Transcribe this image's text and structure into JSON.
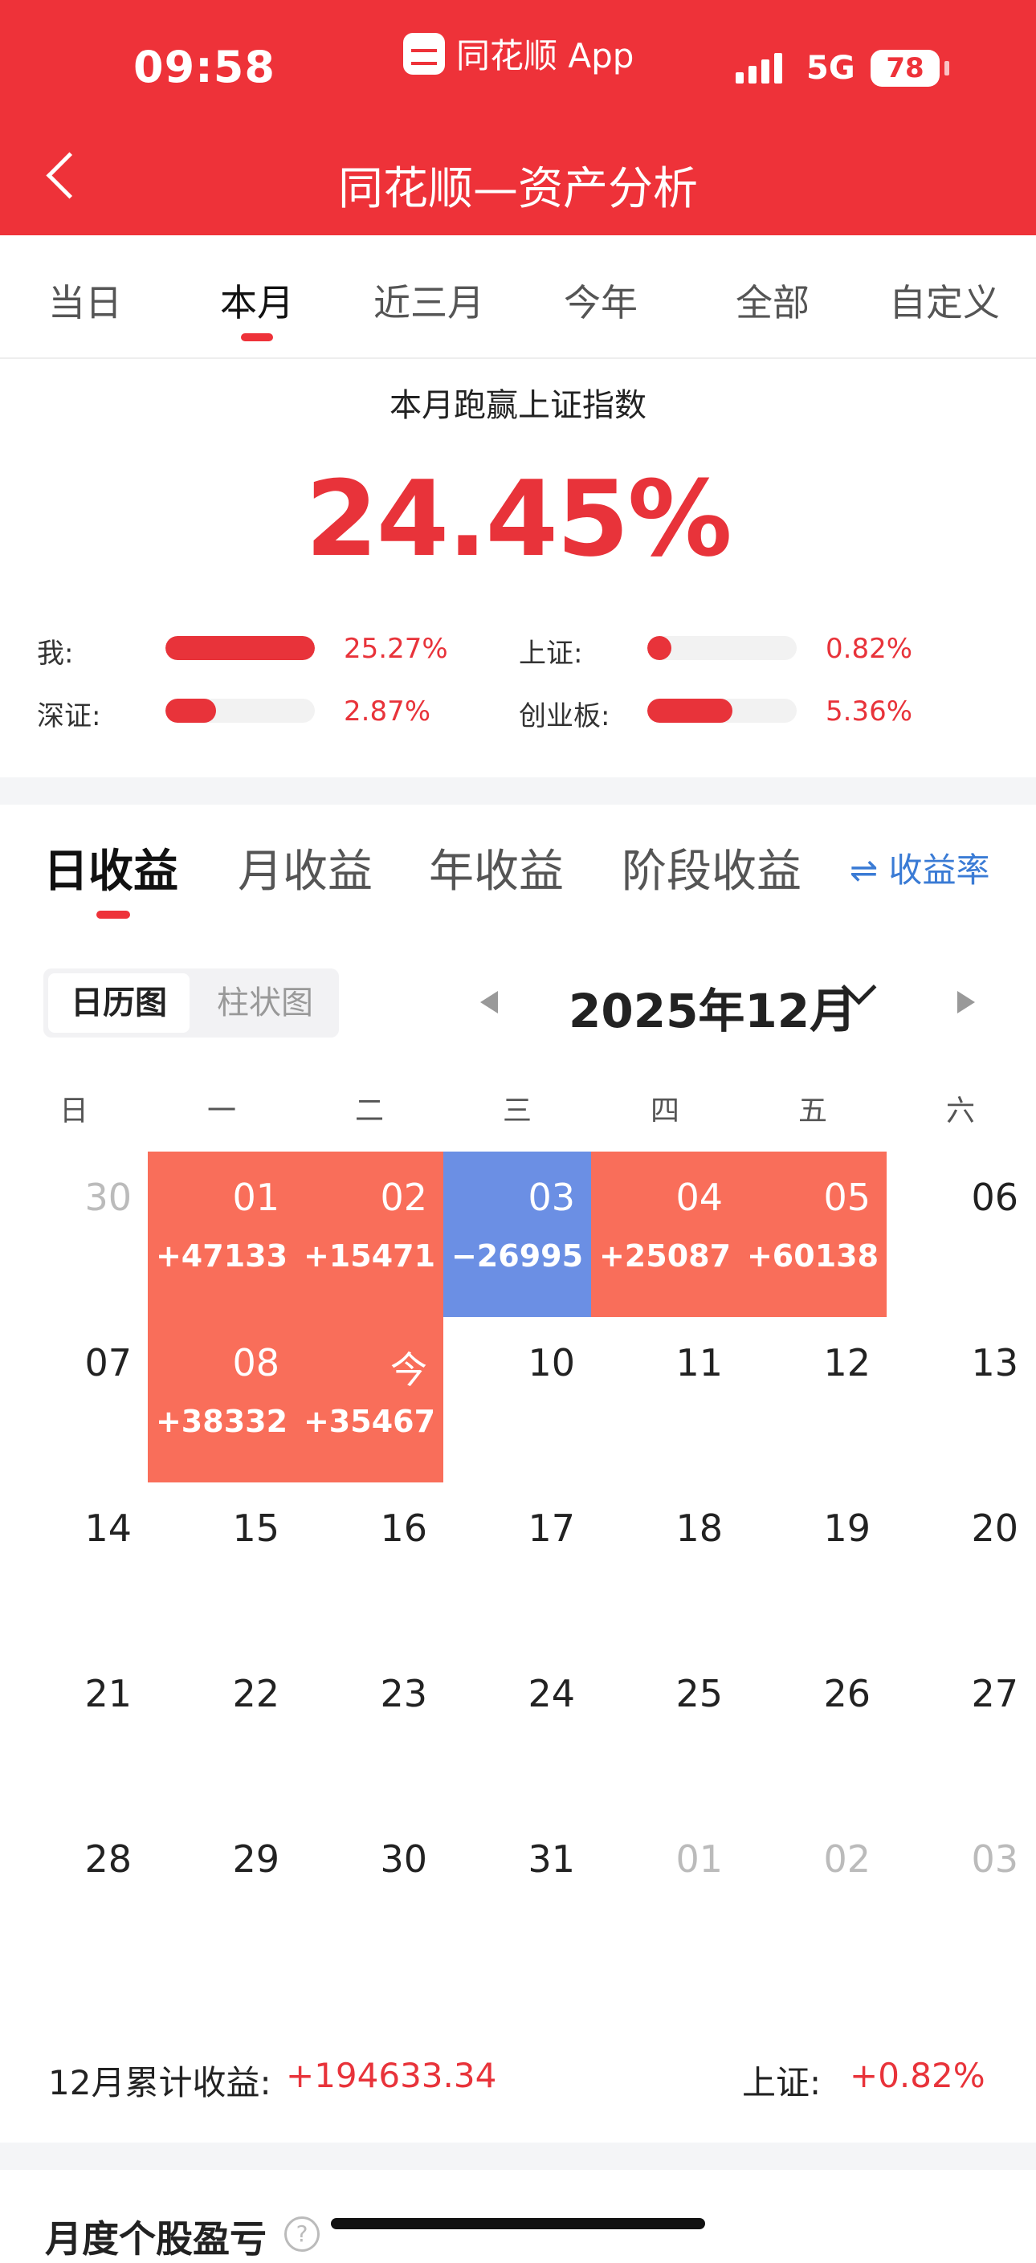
{
  "status_bar": {
    "time": "09:58",
    "app_name": "同花顺 App",
    "network": "5G",
    "battery": "78"
  },
  "header": {
    "title": "同花顺—资产分析"
  },
  "period_tabs": [
    "当日",
    "本月",
    "近三月",
    "今年",
    "全部",
    "自定义"
  ],
  "summary": {
    "title": "本月跑赢上证指数",
    "value": "24.45%",
    "comparisons": [
      {
        "label": "我:",
        "value": "25.27%",
        "fill": 1.0
      },
      {
        "label": "上证:",
        "value": "0.82%",
        "fill": 0.06
      },
      {
        "label": "深证:",
        "value": "2.87%",
        "fill": 0.34
      },
      {
        "label": "创业板:",
        "value": "5.36%",
        "fill": 0.57
      }
    ]
  },
  "income_tabs": [
    "日收益",
    "月收益",
    "年收益",
    "阶段收益"
  ],
  "rate_toggle": "⇌ 收益率",
  "view_toggle": {
    "calendar": "日历图",
    "bar": "柱状图"
  },
  "month_label": "2025年12月",
  "weekdays": [
    "日",
    "一",
    "二",
    "三",
    "四",
    "五",
    "六"
  ],
  "calendar": [
    [
      {
        "d": "30",
        "s": "out"
      },
      {
        "d": "01",
        "v": "+47133",
        "s": "up"
      },
      {
        "d": "02",
        "v": "+15471",
        "s": "up"
      },
      {
        "d": "03",
        "v": "−26995",
        "s": "down"
      },
      {
        "d": "04",
        "v": "+25087",
        "s": "up"
      },
      {
        "d": "05",
        "v": "+60138",
        "s": "up"
      },
      {
        "d": "06"
      }
    ],
    [
      {
        "d": "07"
      },
      {
        "d": "08",
        "v": "+38332",
        "s": "up"
      },
      {
        "d": "今",
        "v": "+35467",
        "s": "up"
      },
      {
        "d": "10"
      },
      {
        "d": "11"
      },
      {
        "d": "12"
      },
      {
        "d": "13"
      }
    ],
    [
      {
        "d": "14"
      },
      {
        "d": "15"
      },
      {
        "d": "16"
      },
      {
        "d": "17"
      },
      {
        "d": "18"
      },
      {
        "d": "19"
      },
      {
        "d": "20"
      }
    ],
    [
      {
        "d": "21"
      },
      {
        "d": "22"
      },
      {
        "d": "23"
      },
      {
        "d": "24"
      },
      {
        "d": "25"
      },
      {
        "d": "26"
      },
      {
        "d": "27"
      }
    ],
    [
      {
        "d": "28"
      },
      {
        "d": "29"
      },
      {
        "d": "30"
      },
      {
        "d": "31"
      },
      {
        "d": "01",
        "s": "out"
      },
      {
        "d": "02",
        "s": "out"
      },
      {
        "d": "03",
        "s": "out"
      }
    ]
  ],
  "footer": {
    "total_label": "12月累计收益:",
    "total": "+194633.34",
    "sh_label": "上证:",
    "sh_value": "+0.82%"
  },
  "next_section": {
    "title": "月度个股盈亏"
  },
  "colors": {
    "brand": "#ee3239",
    "up": "#f96e5a",
    "down": "#6b8fe4",
    "link": "#3a7bd5"
  }
}
